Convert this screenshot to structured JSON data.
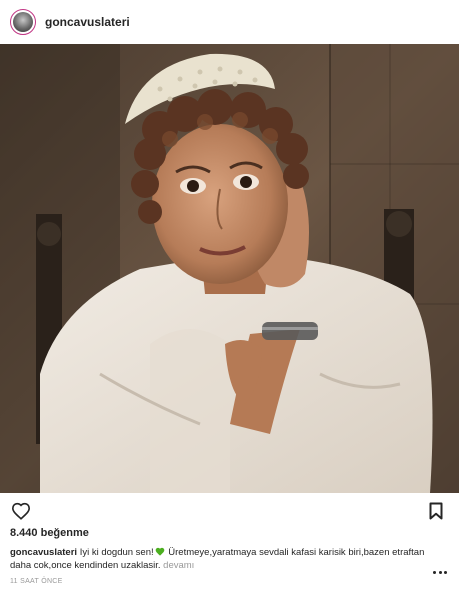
{
  "post": {
    "username": "goncavuslateri",
    "likes_count": "8.440",
    "likes_label": "beğenme",
    "caption_user": "goncavuslateri",
    "caption_part1": "Iyi ki dogdun sen!",
    "caption_emoji": "green-heart",
    "caption_part2": "Üretmeye,yaratmaya sevdali kafasi karisik biri,bazen etraftan daha cok,once kendinden uzaklasir.",
    "more_label": "devamı",
    "timestamp": "11 SAAT ÖNCE"
  },
  "icons": {
    "like": "heart-outline-icon",
    "save": "bookmark-outline-icon",
    "options": "more-dots-icon"
  },
  "colors": {
    "text": "#262626",
    "muted": "#999999",
    "emoji_green": "#4caf20",
    "avatar_ring": "#c13584"
  }
}
